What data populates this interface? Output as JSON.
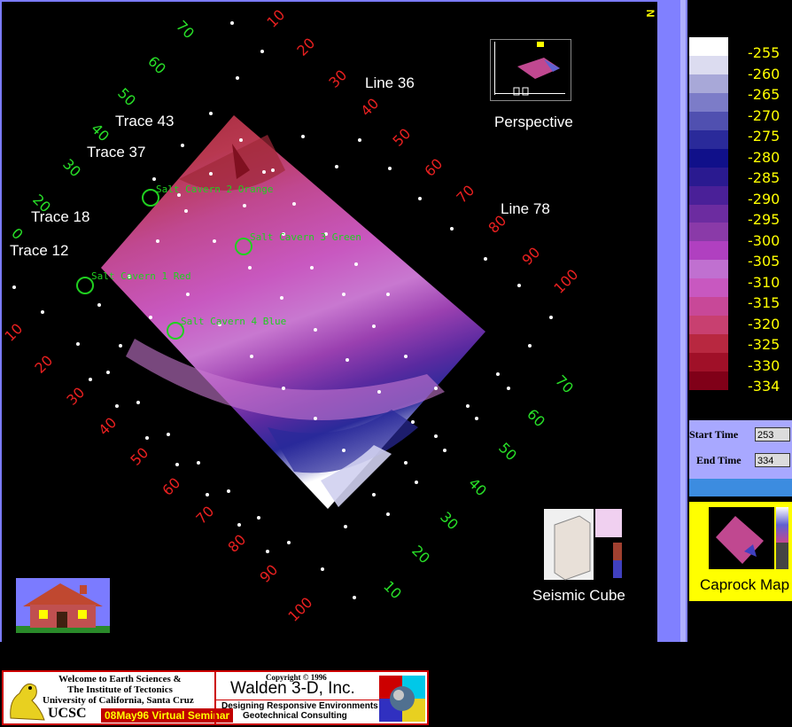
{
  "map": {
    "trace_labels": [
      "Trace 43",
      "Trace 37",
      "Trace 18",
      "Trace 12"
    ],
    "line_labels": [
      "Line 36",
      "Line 78"
    ],
    "caverns": [
      "Salt Cavern 2 Orange",
      "Salt Cavern 3 Green",
      "Salt Cavern 1 Red",
      "Salt Cavern 4 Blue"
    ],
    "perspective_label": "Perspective",
    "seismic_cube_label": "Seismic Cube",
    "north_label": "N",
    "tick_numbers": {
      "green_upper": [
        "70",
        "60",
        "50",
        "40",
        "30",
        "20",
        "0"
      ],
      "red_upper": [
        "10",
        "20",
        "30",
        "40",
        "50",
        "60",
        "70",
        "80",
        "90",
        "100"
      ],
      "red_lower": [
        "10",
        "20",
        "30",
        "40",
        "50",
        "60",
        "70",
        "80",
        "90",
        "100"
      ],
      "green_lower": [
        "70",
        "60",
        "50",
        "40",
        "30",
        "20",
        "10"
      ]
    },
    "colors": {
      "green_tick": "#28e028",
      "red_tick": "#e82020",
      "cavern": "#20d020"
    }
  },
  "legend": {
    "values": [
      "-255",
      "-260",
      "-265",
      "-270",
      "-275",
      "-280",
      "-285",
      "-290",
      "-295",
      "-300",
      "-305",
      "-310",
      "-315",
      "-320",
      "-325",
      "-330",
      "-334"
    ],
    "colors": [
      "#ffffff",
      "#dcdcf0",
      "#a8a8d8",
      "#7c7cc8",
      "#5050b0",
      "#2a2a9a",
      "#10108a",
      "#2a1a90",
      "#4a2098",
      "#6c2ca0",
      "#8a3aa8",
      "#b040c0",
      "#c070d0",
      "#c858c0",
      "#c84898",
      "#c84070",
      "#b82840",
      "#a01028",
      "#800018"
    ],
    "label_color": "#ffff00"
  },
  "time_controls": {
    "start_label": "Start Time",
    "start_value": "253",
    "end_label": "End Time",
    "end_value": "334"
  },
  "caprock": {
    "label": "Caprock Map"
  },
  "banner": {
    "welcome_line1": "Welcome to Earth Sciences &",
    "welcome_line2": "The Institute of Tectonics",
    "welcome_line3": "University of California, Santa Cruz",
    "ucsc": "UCSC",
    "seminar": "08May96 Virtual Seminar",
    "copyright": "Copyright © 1996",
    "company": "Walden 3-D, Inc.",
    "tagline1": "Designing Responsive Environments",
    "tagline2": "Geotechnical Consulting"
  }
}
